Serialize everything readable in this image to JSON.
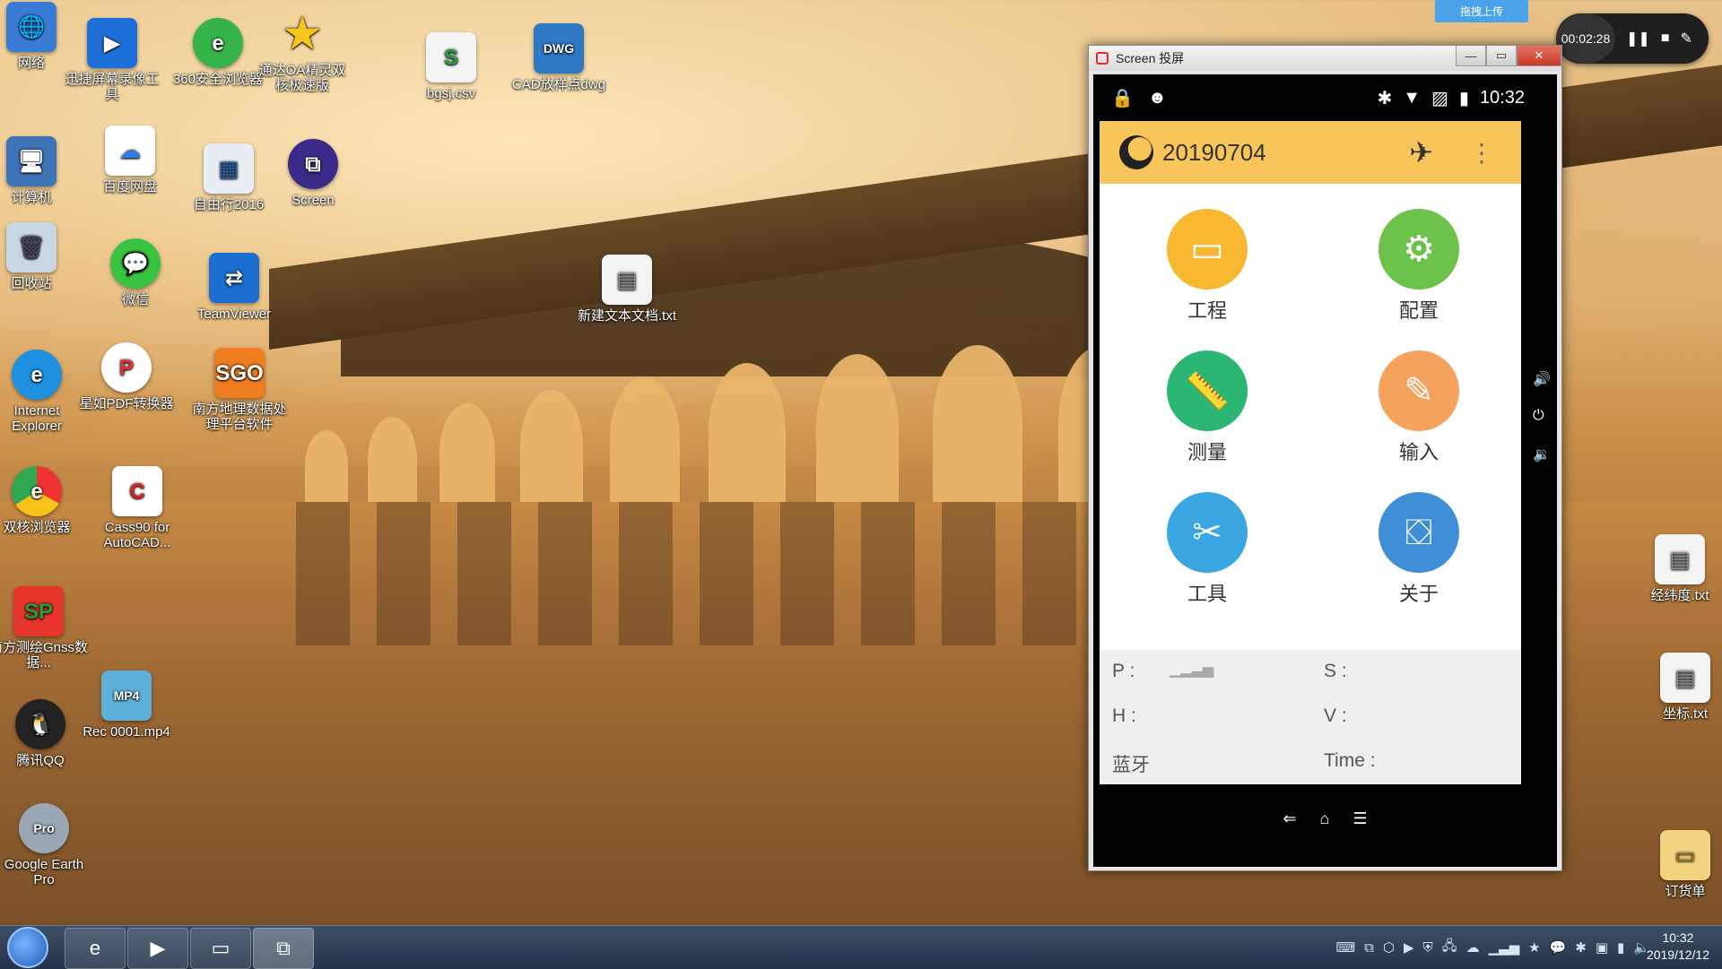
{
  "desktop": {
    "icons": [
      {
        "label": "网络"
      },
      {
        "label": "迅捷屏幕录像工具"
      },
      {
        "label": "360安全浏览器"
      },
      {
        "label": "通达OA精灵双核极速版"
      },
      {
        "label": "bgsj.csv"
      },
      {
        "label": "CAD放样点dwg"
      },
      {
        "label": "计算机"
      },
      {
        "label": "百度网盘"
      },
      {
        "label": "自由行2016"
      },
      {
        "label": "Screen"
      },
      {
        "label": "回收站"
      },
      {
        "label": "微信"
      },
      {
        "label": "TeamViewer"
      },
      {
        "label": "新建文本文档.txt"
      },
      {
        "label": "Internet Explorer"
      },
      {
        "label": "星如PDF转换器"
      },
      {
        "label": "南方地理数据处理平台软件"
      },
      {
        "label": "双核浏览器"
      },
      {
        "label": "Cass90 for AutoCAD..."
      },
      {
        "label": "南方测绘Gnss数据..."
      },
      {
        "label": "Rec 0001.mp4"
      },
      {
        "label": "腾讯QQ"
      },
      {
        "label": "Google Earth Pro"
      },
      {
        "label": "经纬度.txt"
      },
      {
        "label": "坐标.txt"
      },
      {
        "label": "订货单"
      }
    ],
    "icon_glyphs": {
      "sgo": "SGO",
      "pro": "Pro",
      "mp4": "MP4"
    }
  },
  "window": {
    "title": "Screen 投屏",
    "min": "—",
    "max": "▭",
    "close": "✕"
  },
  "phone": {
    "status_time": "10:32",
    "project_name": "20190704",
    "tiles": [
      {
        "label": "工程",
        "color": "#f7b731"
      },
      {
        "label": "配置",
        "color": "#6cc24a"
      },
      {
        "label": "测量",
        "color": "#2bb673"
      },
      {
        "label": "输入",
        "color": "#f5a25d"
      },
      {
        "label": "工具",
        "color": "#3aa7e3"
      },
      {
        "label": "关于",
        "color": "#3f8fd8"
      }
    ],
    "info": {
      "p": "P :",
      "s": "S :",
      "h": "H :",
      "v": "V :",
      "bt": "蓝牙",
      "time": "Time :"
    }
  },
  "recorder": {
    "elapsed": "00:02:28"
  },
  "upload_label": "拖拽上传",
  "taskbar": {
    "clock_time": "10:32",
    "clock_date": "2019/12/12"
  }
}
